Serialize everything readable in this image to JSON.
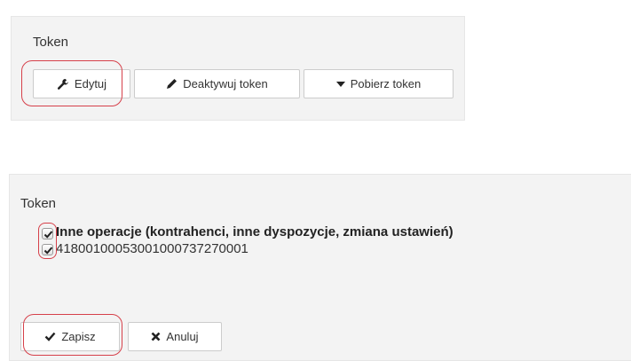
{
  "top_panel": {
    "title": "Token",
    "buttons": {
      "edit": "Edytuj",
      "deactivate": "Deaktywuj token",
      "download": "Pobierz token"
    }
  },
  "bottom_panel": {
    "title": "Token",
    "options": [
      {
        "label": "Inne operacje (kontrahenci, inne dyspozycje, zmiana ustawień)",
        "checked": true
      },
      {
        "label": "41800100053001000737270001",
        "checked": true
      }
    ],
    "buttons": {
      "save": "Zapisz",
      "cancel": "Anuluj"
    }
  },
  "colors": {
    "highlight_ring": "#d6404a",
    "panel_bg": "#f3f3f3"
  }
}
